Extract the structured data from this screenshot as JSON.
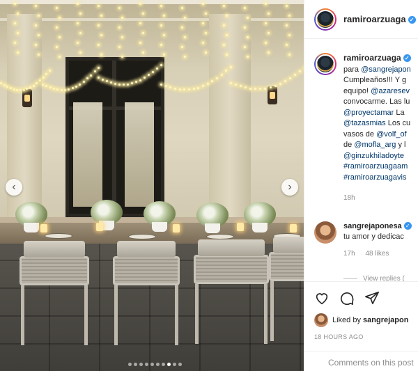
{
  "post": {
    "username": "ramiroarzuaga",
    "verified": true
  },
  "caption": {
    "username": "ramiroarzuaga",
    "lines": [
      {
        "text": "para ",
        "link": "@sangrejapon"
      },
      {
        "text": "Cumpleaños!!! Y g",
        "link": ""
      },
      {
        "text": "equipo! ",
        "link": "@azaresev"
      },
      {
        "text": "convocarme. Las lu",
        "link": ""
      },
      {
        "text": "",
        "link": "@proyectamar",
        "after": " La"
      },
      {
        "text": "",
        "link": "@tazasmias",
        "after": " Los cu"
      },
      {
        "text": "vasos de ",
        "link": "@volf_of"
      },
      {
        "text": "de ",
        "link": "@mofla_arg",
        "after": " y l"
      },
      {
        "text": "",
        "link": "@ginzukhiladoyte"
      },
      {
        "text": "",
        "link": "#ramiroarzuagaam"
      },
      {
        "text": "",
        "link": "#ramiroarzuagavis"
      }
    ],
    "time": "18h"
  },
  "comment": {
    "username": "sangrejaponesa",
    "text": "tu amor y dedicac",
    "time": "17h",
    "likes": "48 likes",
    "view_replies": "View replies ("
  },
  "actions": {
    "liked_by_prefix": "Liked by ",
    "liked_by_user": "sangrejapon",
    "post_date": "18 HOURS AGO"
  },
  "comment_input": {
    "placeholder": "Comments on this post"
  },
  "carousel": {
    "prev_label": "‹",
    "next_label": "›",
    "dot_count": 10,
    "active_dot": 7
  },
  "colors": {
    "link": "#00376b",
    "verified": "#3897f0",
    "muted": "#8e8e8e"
  }
}
